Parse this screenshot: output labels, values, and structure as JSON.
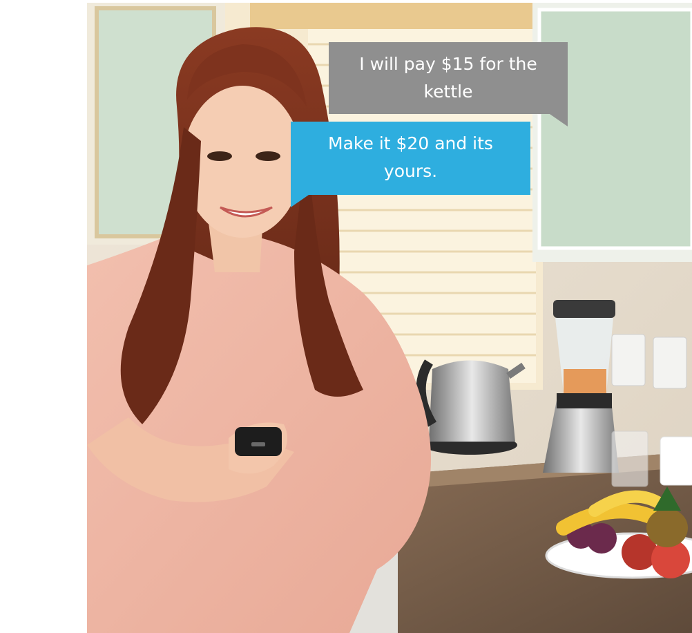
{
  "messages": {
    "gray": {
      "line1": "I will pay $15 for the",
      "line2": "kettle"
    },
    "blue": {
      "line1": "Make it $20 and its",
      "line2": "yours."
    }
  },
  "colors": {
    "gray_bubble": "#8f8f8f",
    "blue_bubble": "#2eaedf"
  }
}
